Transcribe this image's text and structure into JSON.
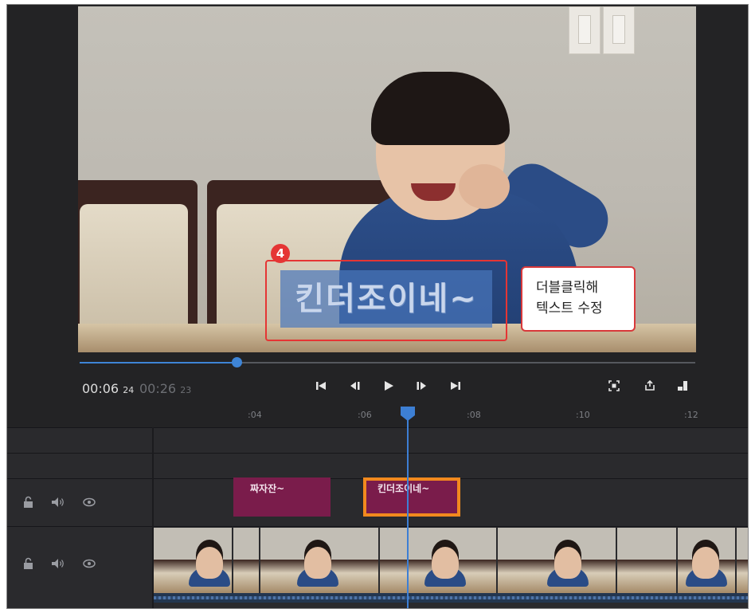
{
  "preview": {
    "title_text": "킨더조이네~",
    "step_badge": "4",
    "callout": {
      "line1": "더블클릭해",
      "line2": "텍스트 수정"
    },
    "playback_fraction": 0.255
  },
  "transport": {
    "current_time": "00:06",
    "current_frames": "24",
    "total_time": "00:26",
    "total_frames": "23",
    "buttons": [
      "go-to-start",
      "step-back",
      "play",
      "step-forward",
      "go-to-end",
      "fit-to-frame",
      "export-frame",
      "toggle-layout"
    ]
  },
  "timeline": {
    "ruler_ticks": [
      ":04",
      ":06",
      ":08",
      ":10",
      ":12"
    ],
    "title_clips": [
      {
        "label": "짜자잔~",
        "selected": false
      },
      {
        "label": "킨더조이네~",
        "selected": true
      }
    ],
    "track_header_icons": [
      "lock-icon",
      "speaker-icon",
      "eye-icon"
    ],
    "colors": {
      "playhead": "#3d7fd4",
      "title_clip": "#7a1c4b",
      "selection": "#f2891e",
      "annotation": "#e53534"
    }
  }
}
